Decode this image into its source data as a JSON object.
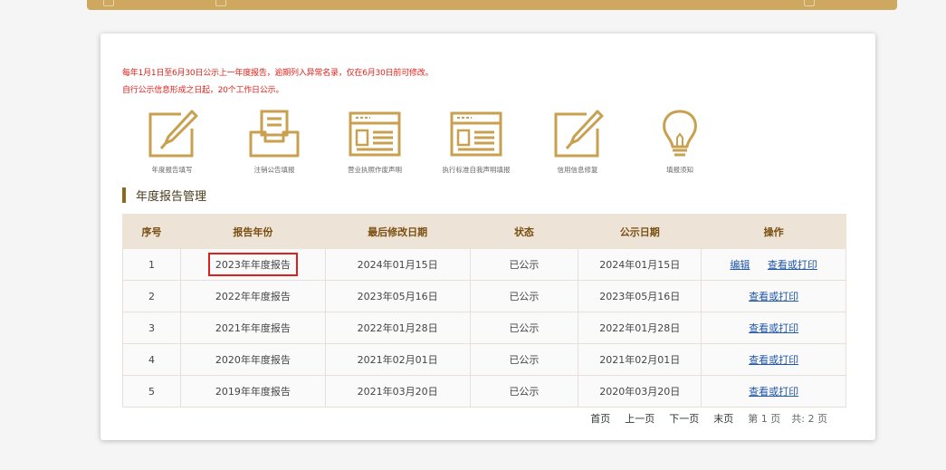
{
  "notices": [
    "每年1月1日至6月30日公示上一年度报告，逾期列入异常名录，仅在6月30日前可修改。",
    "自行公示信息形成之日起，20个工作日公示。"
  ],
  "functions": [
    {
      "label": "年度报告填写",
      "icon": "edit-document-icon"
    },
    {
      "label": "注销公告填报",
      "icon": "inbox-tray-icon"
    },
    {
      "label": "营业执照作废声明",
      "icon": "license-card-icon"
    },
    {
      "label": "执行标准自我声明填报",
      "icon": "standard-card-icon"
    },
    {
      "label": "信用信息修复",
      "icon": "repair-edit-icon"
    },
    {
      "label": "填报须知",
      "icon": "lightbulb-icon"
    }
  ],
  "section_title": "年度报告管理",
  "table": {
    "headers": [
      "序号",
      "报告年份",
      "最后修改日期",
      "状态",
      "公示日期",
      "操作"
    ],
    "rows": [
      {
        "no": "1",
        "year": "2023年年度报告",
        "modified": "2024年01月15日",
        "status": "已公示",
        "published": "2024年01月15日",
        "ops": [
          "编辑",
          "查看或打印"
        ]
      },
      {
        "no": "2",
        "year": "2022年年度报告",
        "modified": "2023年05月16日",
        "status": "已公示",
        "published": "2023年05月16日",
        "ops": [
          "查看或打印"
        ]
      },
      {
        "no": "3",
        "year": "2021年年度报告",
        "modified": "2022年01月28日",
        "status": "已公示",
        "published": "2022年01月28日",
        "ops": [
          "查看或打印"
        ]
      },
      {
        "no": "4",
        "year": "2020年年度报告",
        "modified": "2021年02月01日",
        "status": "已公示",
        "published": "2021年02月01日",
        "ops": [
          "查看或打印"
        ]
      },
      {
        "no": "5",
        "year": "2019年年度报告",
        "modified": "2021年03月20日",
        "status": "已公示",
        "published": "2020年03月20日",
        "ops": [
          "查看或打印"
        ]
      }
    ]
  },
  "pager": {
    "first": "首页",
    "prev": "上一页",
    "next": "下一页",
    "last": "末页",
    "current_prefix": "第",
    "current": "1",
    "current_suffix": "页",
    "total_prefix": "共:",
    "total": "2",
    "total_suffix": "页"
  },
  "colors": {
    "accent": "#cfa85f",
    "icon": "#c9a04f",
    "notice": "#e0201a",
    "link": "#2157a8",
    "header_bg": "#ede3d6",
    "highlight": "#d9221e"
  }
}
